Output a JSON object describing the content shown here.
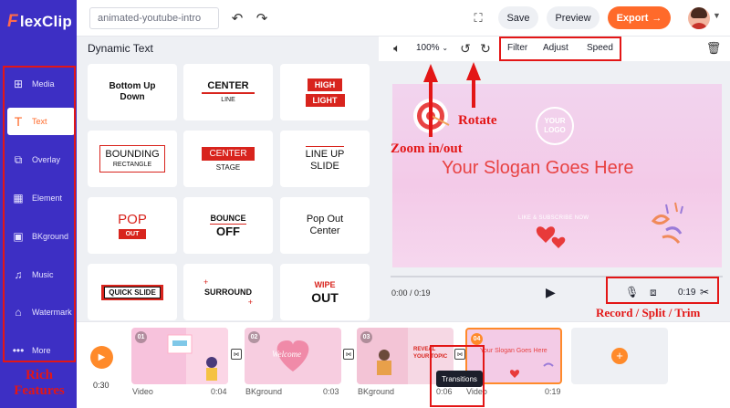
{
  "app": {
    "logo_f": "F",
    "logo_rest": "lexClip"
  },
  "sidebar": {
    "items": [
      {
        "label": "Media",
        "icon": "media-plus-icon"
      },
      {
        "label": "Text",
        "icon": "text-t-icon"
      },
      {
        "label": "Overlay",
        "icon": "overlay-icon"
      },
      {
        "label": "Element",
        "icon": "element-icon"
      },
      {
        "label": "BKground",
        "icon": "background-icon"
      },
      {
        "label": "Music",
        "icon": "music-note-icon"
      },
      {
        "label": "Watermark",
        "icon": "stamp-icon"
      },
      {
        "label": "More",
        "icon": "more-dots-icon"
      }
    ],
    "active": "Text"
  },
  "topbar": {
    "project_name": "animated-youtube-intro",
    "save_label": "Save",
    "preview_label": "Preview",
    "export_label": "Export"
  },
  "panel": {
    "title": "Dynamic Text",
    "tiles": [
      {
        "line1": "Bottom Up",
        "line2": "Down"
      },
      {
        "line1": "CENTER",
        "line2": "LINE"
      },
      {
        "line1": "HIGH",
        "line2": "LIGHT"
      },
      {
        "line1": "BOUNDING",
        "line2": "RECTANGLE"
      },
      {
        "line1": "CENTER",
        "line2": "STAGE"
      },
      {
        "line1": "LINE UP",
        "line2": "SLIDE"
      },
      {
        "line1": "POP",
        "line2": "OUT"
      },
      {
        "line1": "BOUNCE",
        "line2": "OFF"
      },
      {
        "line1": "Pop Out",
        "line2": "Center"
      },
      {
        "line1": "QUICK SLIDE",
        "line2": ""
      },
      {
        "line1": "SURROUND",
        "line2": ""
      },
      {
        "line1": "WIPE",
        "line2": "OUT"
      }
    ]
  },
  "preview": {
    "zoom": "100%",
    "tabs": [
      "Filter",
      "Adjust",
      "Speed"
    ],
    "canvas": {
      "logo_line1": "YOUR",
      "logo_line2": "LOGO",
      "slogan": "Your Slogan Goes Here",
      "like_subscribe": "LIKE & SUBSCRIBE NOW"
    },
    "time": "0:00 / 0:19",
    "duration": "0:19"
  },
  "annotations": {
    "rotate": "Rotate",
    "zoom": "Zoom in/out",
    "record": "Record / Split / Trim",
    "rich": "Rich Features"
  },
  "timeline": {
    "total": "0:30",
    "clips": [
      {
        "num": "01",
        "name": "Video",
        "dur": "0:04"
      },
      {
        "num": "02",
        "name": "BKground",
        "dur": "0:03",
        "thumb_text": "Welcome"
      },
      {
        "num": "03",
        "name": "BKground",
        "dur": "0:06",
        "thumb_text": "REVEAL YOUR TOPIC"
      },
      {
        "num": "04",
        "name": "Video",
        "dur": "0:19",
        "thumb_text": "Your Slogan Goes Here"
      }
    ],
    "tooltip": "Transitions"
  },
  "colors": {
    "sidebar": "#3d2fc4",
    "accent": "#ff6a2a",
    "annotation": "#e31616"
  }
}
